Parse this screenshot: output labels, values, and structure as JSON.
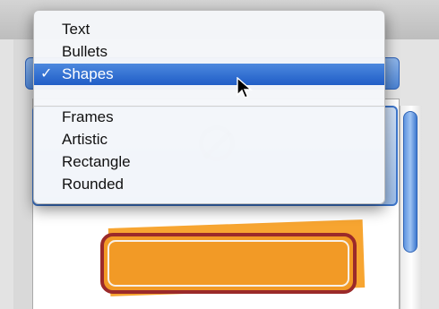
{
  "menu": {
    "items_top": [
      {
        "label": "Text"
      },
      {
        "label": "Bullets"
      },
      {
        "label": "Shapes",
        "selected": true,
        "check": "✓"
      }
    ],
    "items_bottom": [
      {
        "label": "Frames"
      },
      {
        "label": "Artistic"
      },
      {
        "label": "Rectangle"
      },
      {
        "label": "Rounded"
      }
    ]
  },
  "colors": {
    "selection": "#1f5dc7",
    "shape_fill": "#f29a26",
    "shape_stroke": "#9b2a2a"
  },
  "icons": {
    "checkmark": "checkmark-icon",
    "cursor": "arrow-cursor-icon",
    "prohibit": "prohibit-icon"
  }
}
